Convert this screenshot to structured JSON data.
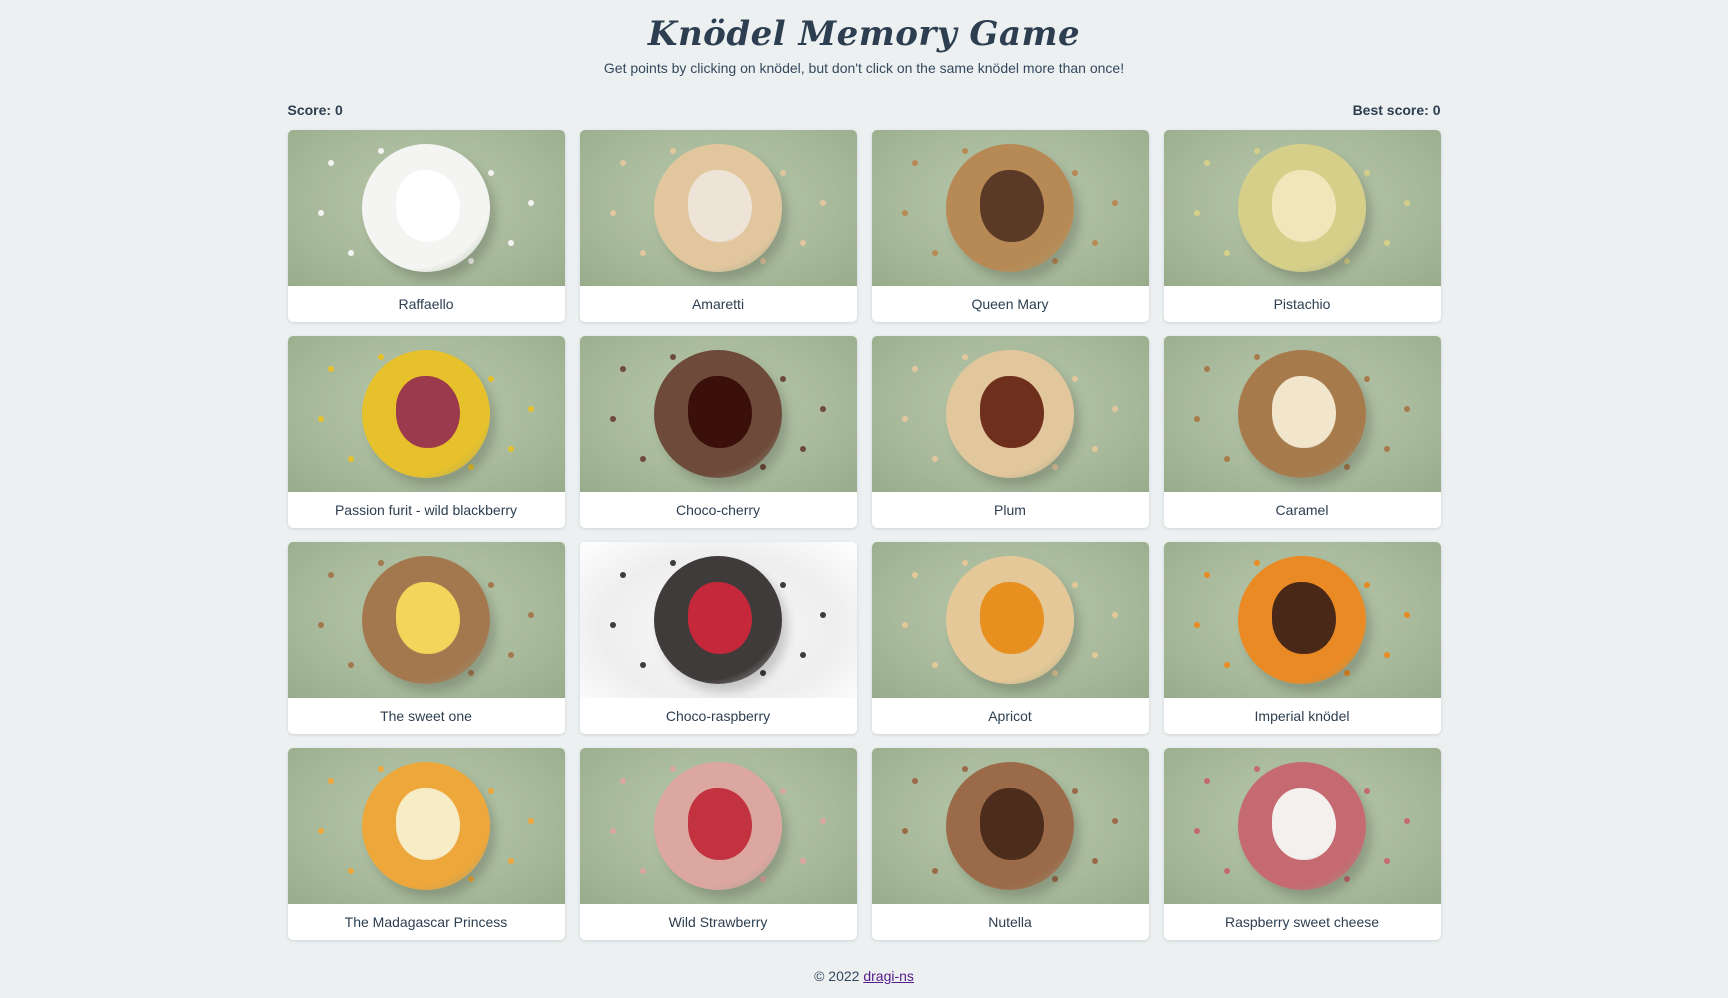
{
  "header": {
    "title": "Knödel Memory Game",
    "subtitle": "Get points by clicking on knödel, but don't click on the same knödel more than once!"
  },
  "scores": {
    "score_label": "Score: 0",
    "best_label": "Best score: 0"
  },
  "cards": [
    {
      "label": "Raffaello",
      "coating": "#f4f4f2",
      "filling": "#ffffff",
      "plate": "green"
    },
    {
      "label": "Amaretti",
      "coating": "#e2c79e",
      "filling": "#ede3d6",
      "plate": "green"
    },
    {
      "label": "Queen Mary",
      "coating": "#b78a55",
      "filling": "#5a3a26",
      "plate": "green"
    },
    {
      "label": "Pistachio",
      "coating": "#d6cf8a",
      "filling": "#efe7b9",
      "plate": "green"
    },
    {
      "label": "Passion furit - wild blackberry",
      "coating": "#e7c12b",
      "filling": "#9b3a4d",
      "plate": "green"
    },
    {
      "label": "Choco-cherry",
      "coating": "#6e4a3a",
      "filling": "#3b0f0a",
      "plate": "green"
    },
    {
      "label": "Plum",
      "coating": "#e3c79c",
      "filling": "#6e2f1c",
      "plate": "green"
    },
    {
      "label": "Caramel",
      "coating": "#a77a4c",
      "filling": "#f1e5cc",
      "plate": "green"
    },
    {
      "label": "The sweet one",
      "coating": "#a4784f",
      "filling": "#f3d55b",
      "plate": "green"
    },
    {
      "label": "Choco-raspberry",
      "coating": "#3f3b3a",
      "filling": "#c4283a",
      "plate": "white"
    },
    {
      "label": "Apricot",
      "coating": "#e5c897",
      "filling": "#e8901f",
      "plate": "green"
    },
    {
      "label": "Imperial knödel",
      "coating": "#e98a24",
      "filling": "#4a2818",
      "plate": "green"
    },
    {
      "label": "The Madagascar Princess",
      "coating": "#eda73a",
      "filling": "#f6ecc6",
      "plate": "green"
    },
    {
      "label": "Wild Strawberry",
      "coating": "#dba7a0",
      "filling": "#c2323f",
      "plate": "green"
    },
    {
      "label": "Nutella",
      "coating": "#9b6a49",
      "filling": "#4c2c1a",
      "plate": "green"
    },
    {
      "label": "Raspberry sweet cheese",
      "coating": "#c56a70",
      "filling": "#f4f0ee",
      "plate": "green"
    }
  ],
  "footer": {
    "copyright": "© 2022",
    "author_link": "dragi-ns"
  },
  "colors": {
    "background": "#ecf0f1",
    "text": "#2c3e50",
    "link": "#551a8b"
  }
}
